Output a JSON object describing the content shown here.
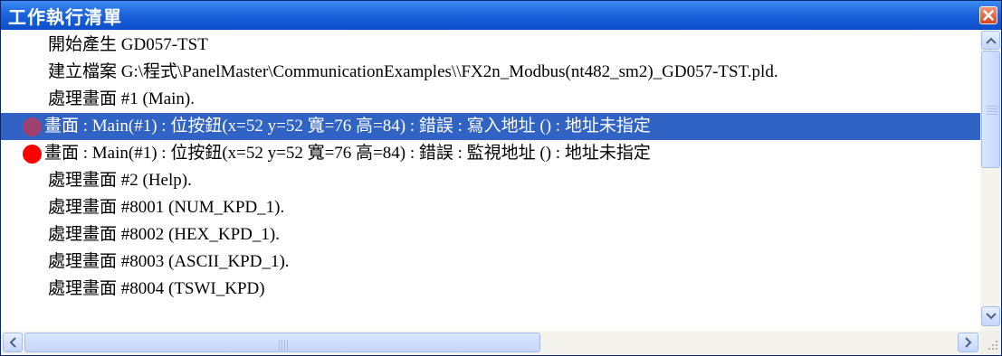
{
  "window": {
    "title": "工作執行清單",
    "close_icon": "close-icon",
    "colors": {
      "titlebar": "#1c64dc",
      "selection": "#3163c4",
      "error_dot": "#ff0000",
      "selected_dot": "#a04070"
    }
  },
  "log": {
    "rows": [
      {
        "text": "開始產生 GD057-TST",
        "status": "info"
      },
      {
        "text": "建立檔案 G:\\程式\\PanelMaster\\CommunicationExamples\\\\FX2n_Modbus(nt482_sm2)_GD057-TST.pld.",
        "status": "info"
      },
      {
        "text": "處理畫面 #1 (Main).",
        "status": "info"
      },
      {
        "text": "畫面 : Main(#1) : 位按鈕(x=52 y=52 寬=76 高=84) : 錯誤 : 寫入地址 () : 地址未指定",
        "status": "error",
        "selected": true
      },
      {
        "text": "畫面 : Main(#1) : 位按鈕(x=52 y=52 寬=76 高=84) : 錯誤 : 監視地址 () : 地址未指定",
        "status": "error"
      },
      {
        "text": "處理畫面 #2 (Help).",
        "status": "info"
      },
      {
        "text": "處理畫面 #8001 (NUM_KPD_1).",
        "status": "info"
      },
      {
        "text": "處理畫面 #8002 (HEX_KPD_1).",
        "status": "info"
      },
      {
        "text": "處理畫面 #8003 (ASCII_KPD_1).",
        "status": "info"
      },
      {
        "text": "處理畫面 #8004 (TSWI_KPD)",
        "status": "info"
      }
    ]
  },
  "scrollbars": {
    "vertical": {
      "up_icon": "chevron-up-icon",
      "down_icon": "chevron-down-icon",
      "position": 0.0
    },
    "horizontal": {
      "left_icon": "chevron-left-icon",
      "right_icon": "chevron-right-icon",
      "position": 0.0
    }
  }
}
